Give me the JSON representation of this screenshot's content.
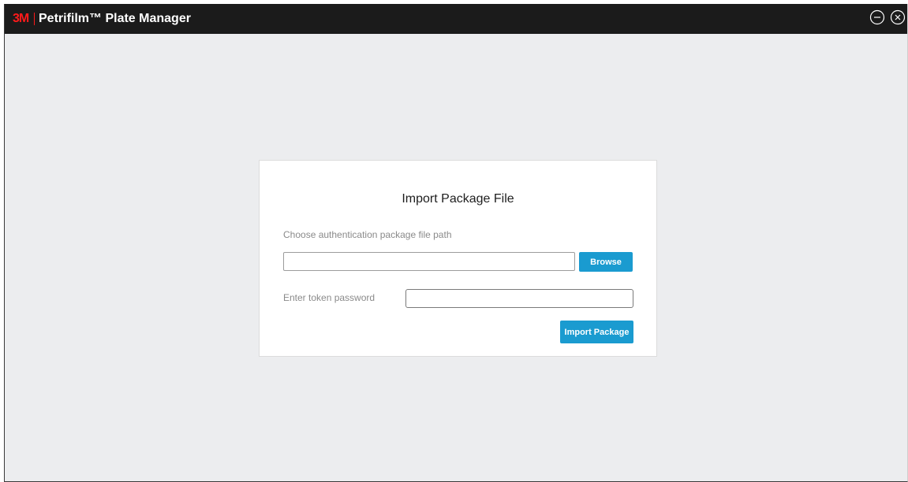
{
  "window": {
    "brand": "3M",
    "title": "Petrifilm™ Plate Manager",
    "minimize_icon": "minus-circle-icon",
    "close_icon": "x-circle-icon"
  },
  "dialog": {
    "title": "Import Package File",
    "file_path_label": "Choose authentication package file path",
    "file_path_value": "",
    "browse_label": "Browse",
    "password_label": "Enter token password",
    "password_value": "",
    "import_label": "Import Package"
  },
  "colors": {
    "titlebar": "#1b1b1b",
    "brand_red": "#ff1a1a",
    "background": "#ecedef",
    "accent": "#1a9bd0"
  }
}
